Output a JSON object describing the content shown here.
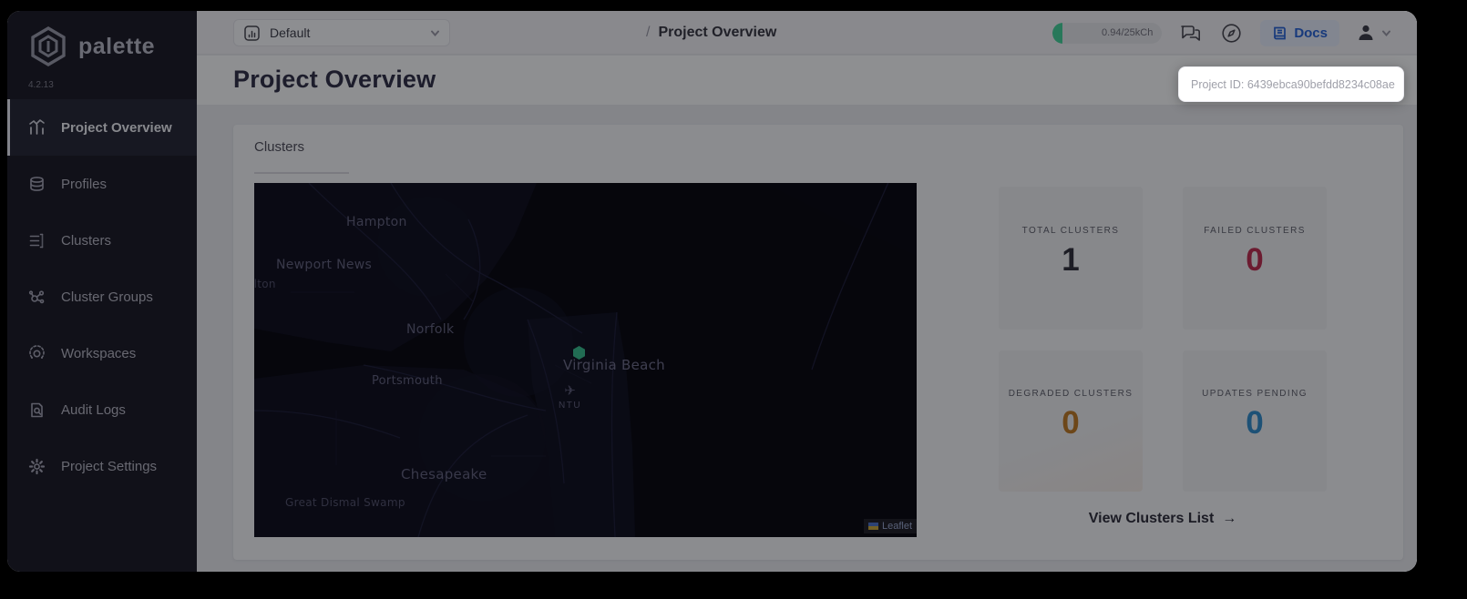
{
  "app": {
    "name": "palette",
    "version": "4.2.13"
  },
  "sidebar": {
    "items": [
      {
        "label": "Project Overview",
        "icon": "bar-chart-icon",
        "active": true
      },
      {
        "label": "Profiles",
        "icon": "layers-stack-icon",
        "active": false
      },
      {
        "label": "Clusters",
        "icon": "server-list-icon",
        "active": false
      },
      {
        "label": "Cluster Groups",
        "icon": "network-nodes-icon",
        "active": false
      },
      {
        "label": "Workspaces",
        "icon": "orbit-icon",
        "active": false
      },
      {
        "label": "Audit Logs",
        "icon": "audit-document-icon",
        "active": false
      },
      {
        "label": "Project Settings",
        "icon": "gear-icon",
        "active": false
      }
    ]
  },
  "topbar": {
    "project_selector": {
      "value": "Default",
      "icon": "chart-tile-icon"
    },
    "breadcrumb": {
      "separator": "/",
      "current": "Project Overview"
    },
    "usage_badge": {
      "text": "0.94/25kCh",
      "accent_color": "#42d49a"
    },
    "docs_button": {
      "label": "Docs",
      "color": "#2563d8"
    },
    "icons": [
      "chat-icon",
      "compass-icon",
      "user-icon",
      "chevron-down-icon"
    ]
  },
  "project_id_tooltip": {
    "text": "Project ID: 6439ebca90befdd8234c08ae"
  },
  "page": {
    "title": "Project Overview"
  },
  "clusters": {
    "title": "Clusters",
    "map": {
      "labels": [
        "Hampton",
        "Newport News",
        "llton",
        "Norfolk",
        "Virginia Beach",
        "Portsmouth",
        "Chesapeake",
        "Great Dismal Swamp"
      ],
      "airport_code": "NTU",
      "airplane_glyph": "✈",
      "marker_color": "#35bd8c",
      "attribution": "Leaflet"
    },
    "stats": [
      {
        "label": "TOTAL CLUSTERS",
        "value": "1",
        "color": "#2e2f39"
      },
      {
        "label": "FAILED CLUSTERS",
        "value": "0",
        "color": "#bd2a4e"
      },
      {
        "label": "DEGRADED CLUSTERS",
        "value": "0",
        "color": "#bf7a24"
      },
      {
        "label": "UPDATES PENDING",
        "value": "0",
        "color": "#2f8ccc"
      }
    ],
    "view_link": {
      "label": "View Clusters List",
      "arrow": "→"
    }
  }
}
